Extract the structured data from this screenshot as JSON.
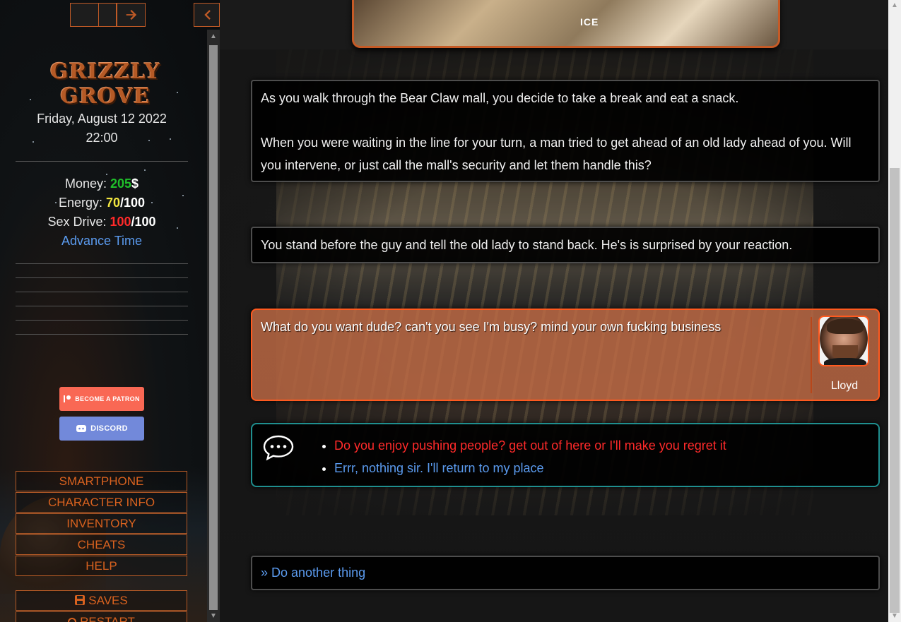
{
  "sidebar": {
    "title": "GRIZZLY GROVE",
    "date": "Friday, August 12 2022",
    "time": "22:00",
    "stats": {
      "money_label": "Money: ",
      "money_value": "205",
      "money_unit": "$",
      "energy_label": "Energy: ",
      "energy_value": "70",
      "energy_max": "/100",
      "sex_drive_label": "Sex Drive: ",
      "sex_drive_value": "100",
      "sex_drive_max": "/100"
    },
    "advance_time": "Advance Time",
    "patreon_label": "BECOME A PATRON",
    "discord_label": "DISCORD",
    "menu": {
      "smartphone": "SMARTPHONE",
      "character_info": "CHARACTER INFO",
      "inventory": "INVENTORY",
      "cheats": "CHEATS",
      "help": "HELP",
      "saves": "SAVES",
      "restart": "RESTART"
    },
    "icons": {
      "back": "arrow-left-icon",
      "forward": "arrow-right-icon",
      "collapse": "chevron-left-icon",
      "saves": "floppy-disk-icon",
      "restart": "power-icon"
    }
  },
  "main": {
    "top_image_sign": "ICE",
    "narration_1_p1": "As you walk through the Bear Claw mall, you decide to take a break and eat a snack.",
    "narration_1_p2": "When you were waiting in the line for your turn, a man tried to get ahead of an old lady ahead of you. Will you intervene, or just call the mall's security and let them handle this?",
    "narration_2": "You stand before the guy and tell the old lady to stand back. He's is surprised by your reaction.",
    "dialogue": {
      "text": "What do you want dude? can't you see I'm busy? mind your own fucking business",
      "speaker": "Lloyd"
    },
    "choices": [
      "Do you enjoy pushing people? get out of here or I'll make you regret it",
      "Errr, nothing sir. I'll return to my place"
    ],
    "other_link": "» Do another thing"
  },
  "colors": {
    "accent": "#c05a26",
    "money": "#1fbf2a",
    "energy": "#f2e640",
    "sex_drive": "#ff2a2a",
    "link": "#5b9bef",
    "dialogue_bg": "#c86e46",
    "choice_border": "#1f8f8f"
  }
}
